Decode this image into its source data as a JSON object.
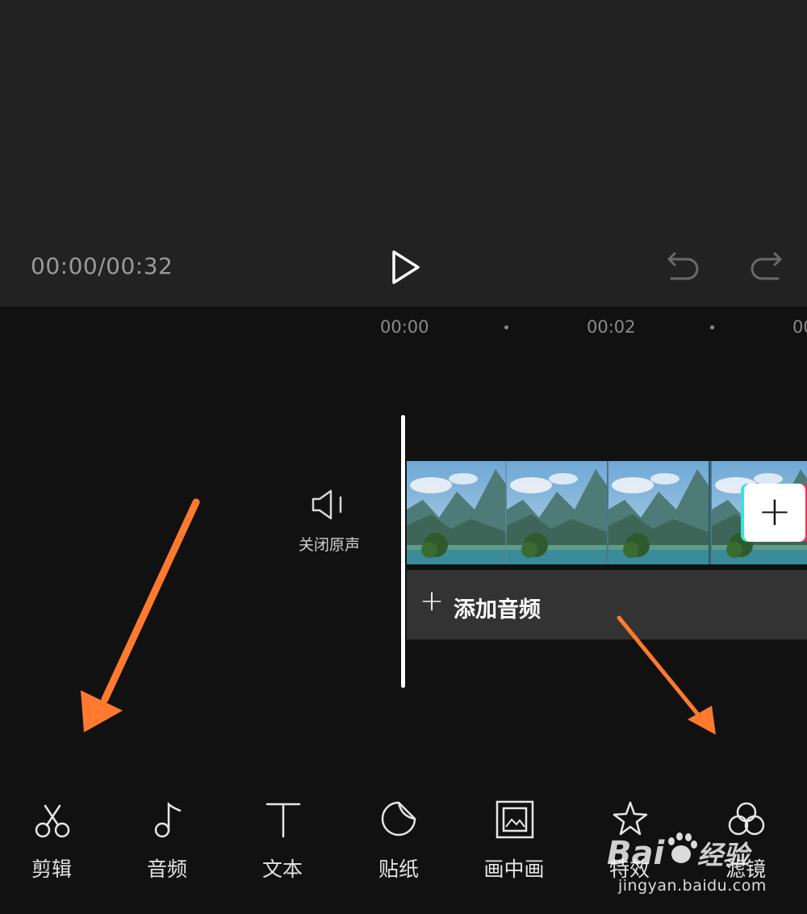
{
  "player": {
    "time_readout": "00:00/00:32",
    "play_icon": "play-icon",
    "undo_icon": "undo-icon",
    "redo_icon": "redo-icon"
  },
  "timeline": {
    "ticks": [
      "00:00",
      "00:02",
      "00"
    ],
    "mute_label": "关闭原声",
    "add_audio_label": "添加音频",
    "add_clip_icon": "plus-icon"
  },
  "toolbar": {
    "items": [
      {
        "label": "剪辑",
        "icon": "scissors-icon"
      },
      {
        "label": "音频",
        "icon": "music-note-icon"
      },
      {
        "label": "文本",
        "icon": "text-icon"
      },
      {
        "label": "贴纸",
        "icon": "sticker-icon"
      },
      {
        "label": "画中画",
        "icon": "picture-in-picture-icon"
      },
      {
        "label": "特效",
        "icon": "effects-star-icon"
      },
      {
        "label": "滤镜",
        "icon": "filter-icon"
      }
    ]
  },
  "watermark": {
    "logo": "Bai 经验",
    "url": "jingyan.baidu.com"
  },
  "colors": {
    "arrow": "#ff7a2e",
    "preview_bg": "#222222",
    "editor_bg": "#111111"
  }
}
